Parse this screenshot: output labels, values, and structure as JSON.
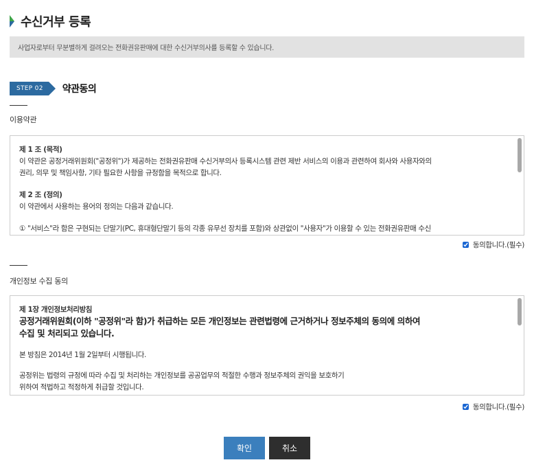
{
  "header": {
    "title": "수신거부 등록",
    "mark_colors": [
      "#2c6aa0",
      "#3fa548"
    ]
  },
  "notice": {
    "text": "사업자로부터 무분별하게 걸려오는 전화권유판매에 대한 수신거부의사를 등록할 수 있습니다."
  },
  "step": {
    "badge": "STEP 02",
    "title": "약관동의",
    "color": "#2c6aa0"
  },
  "terms": {
    "label": "이용약관",
    "article1_head": "제 1 조 (목적)",
    "article1_line1": "이 약관은 공정거래위원회(\"공정위\")가 제공하는 전화권유판매 수신거부의사 등록시스템 관련 제반 서비스의 이용과 관련하여 회사와 사용자와의",
    "article1_line2": "권리, 의무 및 책임사항, 기타 필요한 사항을 규정함을 목적으로 합니다.",
    "article2_head": "제 2 조 (정의)",
    "article2_line1": "이 약관에서 사용하는 용어의 정의는 다음과 같습니다.",
    "article2_item1": "① \"서비스\"라 함은 구현되는 단말기(PC, 휴대형단말기 등의 각종 유무선 장치를 포함)와 상관없이 \"사용자\"가 이용할 수 있는 전화권유판매 수신",
    "agree_label": "동의합니다.(필수)",
    "agree_checked": true
  },
  "privacy": {
    "label": "개인정보 수집 동의",
    "chapter_head": "제 1장 개인정보처리방침",
    "intro_line1": " 공정거래위원회(이하 \"공정위\"라 함)가 취급하는 모든 개인정보는 관련법령에 근거하거나 정보주체의 동의에 의하여",
    "intro_line2": "수집 및 처리되고 있습니다.",
    "effective": " 본 방침은 2014년 1월 2일부터 시행됩니다.",
    "body_line1": " 공정위는 법령의 규정에 따라 수집 및 처리하는 개인정보를 공공업무의 적절한 수행과 정보주체의 권익을 보호하기",
    "body_line2": "위하여 적법하고 적정하게 취급할 것입니다.",
    "agree_label": "동의합니다.(필수)",
    "agree_checked": true
  },
  "buttons": {
    "confirm": "확인",
    "cancel": "취소"
  }
}
